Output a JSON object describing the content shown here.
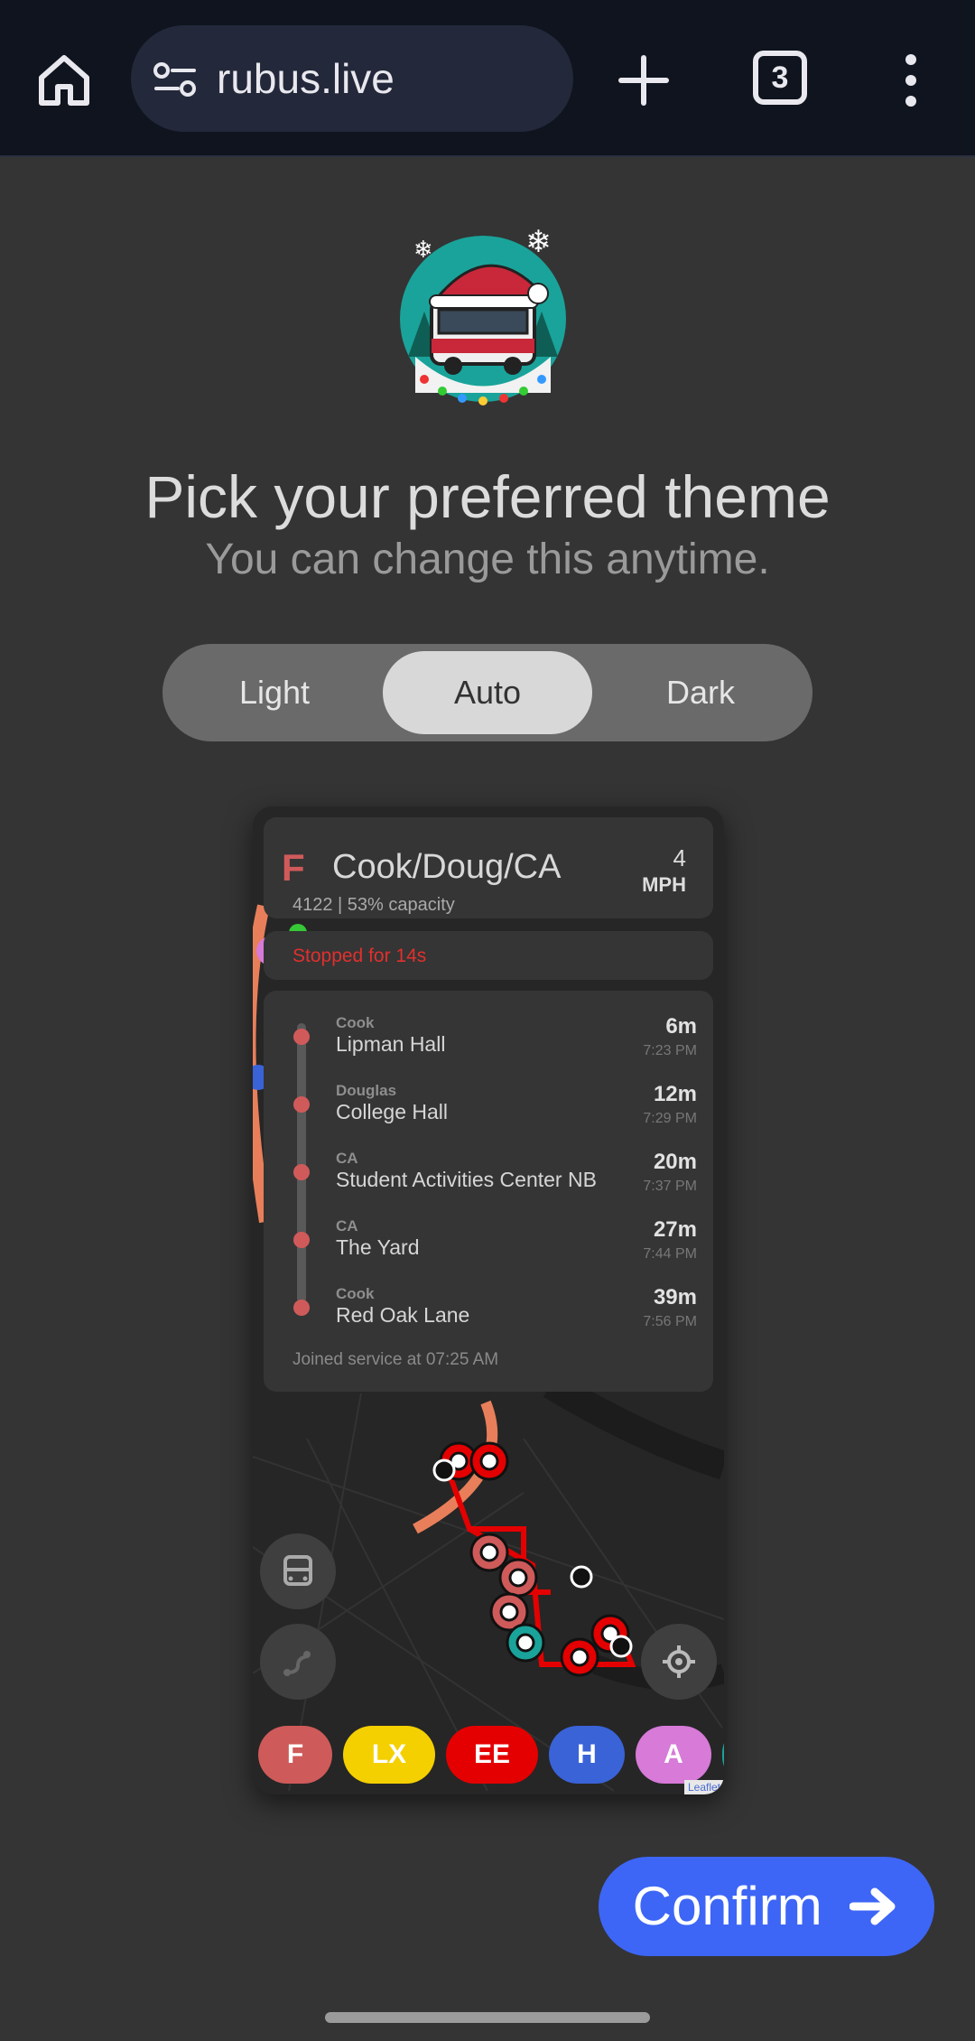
{
  "browser": {
    "url": "rubus.live",
    "tab_count": "3"
  },
  "theme_picker": {
    "title": "Pick your preferred theme",
    "subtitle": "You can change this anytime.",
    "options": [
      "Light",
      "Auto",
      "Dark"
    ],
    "selected": "Auto"
  },
  "preview": {
    "route_letter": "F",
    "route_name": "Cook/Doug/CA",
    "bus_info": "4122 | 53% capacity",
    "speed": "4",
    "speed_unit": "MPH",
    "status": "Stopped for 14s",
    "stops": [
      {
        "street": "Cook",
        "name": "Lipman Hall",
        "mins": "6m",
        "time": "7:23 PM"
      },
      {
        "street": "Douglas",
        "name": "College Hall",
        "mins": "12m",
        "time": "7:29 PM"
      },
      {
        "street": "CA",
        "name": "Student Activities Center NB",
        "mins": "20m",
        "time": "7:37 PM"
      },
      {
        "street": "CA",
        "name": "The Yard",
        "mins": "27m",
        "time": "7:44 PM"
      },
      {
        "street": "Cook",
        "name": "Red Oak Lane",
        "mins": "39m",
        "time": "7:56 PM"
      }
    ],
    "joined": "Joined service at 07:25 AM",
    "route_chips": [
      {
        "label": "F",
        "color": "#cf5a5a"
      },
      {
        "label": "LX",
        "color": "#f4d000"
      },
      {
        "label": "EE",
        "color": "#e40000"
      },
      {
        "label": "H",
        "color": "#3a63d8"
      },
      {
        "label": "A",
        "color": "#d77ad8"
      }
    ],
    "attribution": "Leaflet"
  },
  "confirm_label": "Confirm"
}
